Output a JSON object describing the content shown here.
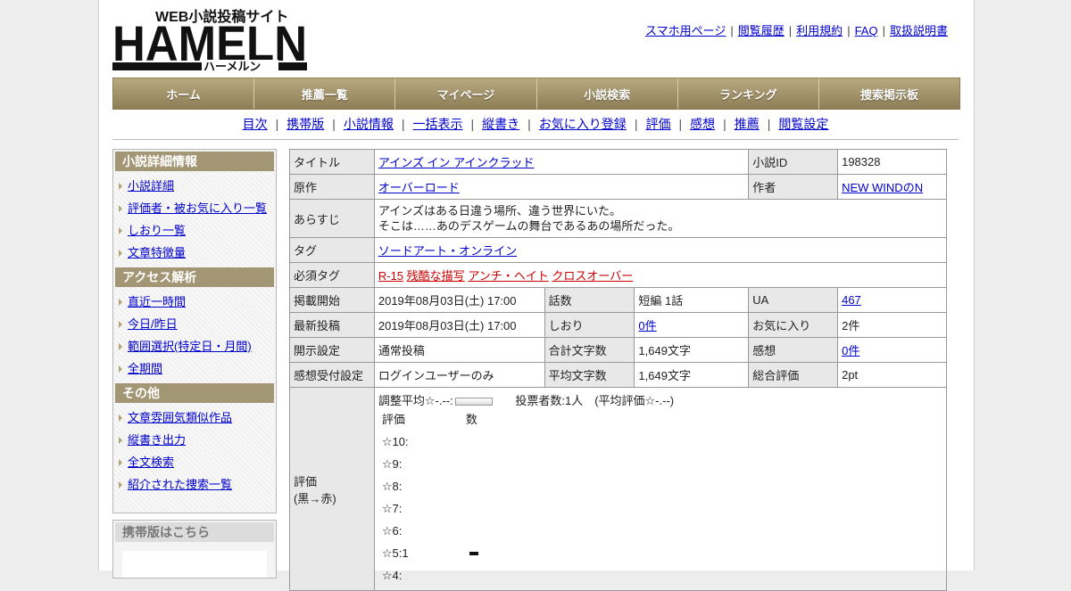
{
  "header": {
    "logo": {
      "tagline": "WEB小説投稿サイト",
      "wordmark": "HAMELN",
      "kana": "ハーメルン"
    },
    "top_links": [
      "スマホ用ページ",
      "閲覧履歴",
      "利用規約",
      "FAQ",
      "取扱説明書"
    ]
  },
  "global_nav": [
    "ホーム",
    "推薦一覧",
    "マイページ",
    "小説検索",
    "ランキング",
    "捜索掲示板"
  ],
  "sub_nav": [
    "目次",
    "携帯版",
    "小説情報",
    "一括表示",
    "縦書き",
    "お気に入り登録",
    "評価",
    "感想",
    "推薦",
    "閲覧設定"
  ],
  "sidebar": {
    "sections": [
      {
        "title": "小説詳細情報",
        "items": [
          "小説詳細",
          "評価者・被お気に入り一覧",
          "しおり一覧",
          "文章特徴量"
        ]
      },
      {
        "title": "アクセス解析",
        "items": [
          "直近一時間",
          "今日/昨日",
          "範囲選択(特定日・月間)",
          "全期間"
        ]
      },
      {
        "title": "その他",
        "items": [
          "文章雰囲気類似作品",
          "縦書き出力",
          "全文検索",
          "紹介された捜索一覧"
        ]
      }
    ],
    "mobile_box_title": "携帯版はこちら"
  },
  "info": {
    "title_label": "タイトル",
    "title": "アインズ イン アインクラッド",
    "novel_id_label": "小説ID",
    "novel_id": "198328",
    "original_label": "原作",
    "original": "オーバーロード",
    "author_label": "作者",
    "author": "NEW WINDのN",
    "synopsis_label": "あらすじ",
    "synopsis_1": "アインズはある日違う場所、違う世界にいた。",
    "synopsis_2": "そこは……あのデスゲームの舞台であるあの場所だった。",
    "tag_label": "タグ",
    "tag": "ソードアート・オンライン",
    "required_tag_label": "必須タグ",
    "required_tags": [
      "R-15",
      "残酷な描写",
      "アンチ・ヘイト",
      "クロスオーバー"
    ],
    "published_label": "掲載開始",
    "published": "2019年08月03日(土) 17:00",
    "chapters_label": "話数",
    "chapters": "短編 1話",
    "ua_label": "UA",
    "ua": "467",
    "latest_label": "最新投稿",
    "latest": "2019年08月03日(土) 17:00",
    "bookmark_label": "しおり",
    "bookmark": "0件",
    "favorite_label": "お気に入り",
    "favorite": "2件",
    "disclosure_label": "開示設定",
    "disclosure": "通常投稿",
    "total_chars_label": "合計文字数",
    "total_chars": "1,649文字",
    "comments_label": "感想",
    "comments": "0件",
    "comment_setting_label": "感想受付設定",
    "comment_setting": "ログインユーザーのみ",
    "avg_chars_label": "平均文字数",
    "avg_chars": "1,649文字",
    "total_rating_label": "総合評価",
    "total_rating": "2pt",
    "rating_label_1": "評価",
    "rating_label_2": "(黒→赤)",
    "adjusted_avg": "調整平均☆-.--:",
    "voters": "投票者数:1人　(平均評価☆-.--)",
    "hist_head_rating": "評価",
    "hist_head_count": "数",
    "histogram": [
      {
        "label": "☆10:",
        "count": 0
      },
      {
        "label": "☆9:",
        "count": 0
      },
      {
        "label": "☆8:",
        "count": 0
      },
      {
        "label": "☆7:",
        "count": 0
      },
      {
        "label": "☆6:",
        "count": 0
      },
      {
        "label": "☆5:1",
        "count": 1
      },
      {
        "label": "☆4:",
        "count": 0
      }
    ]
  }
}
